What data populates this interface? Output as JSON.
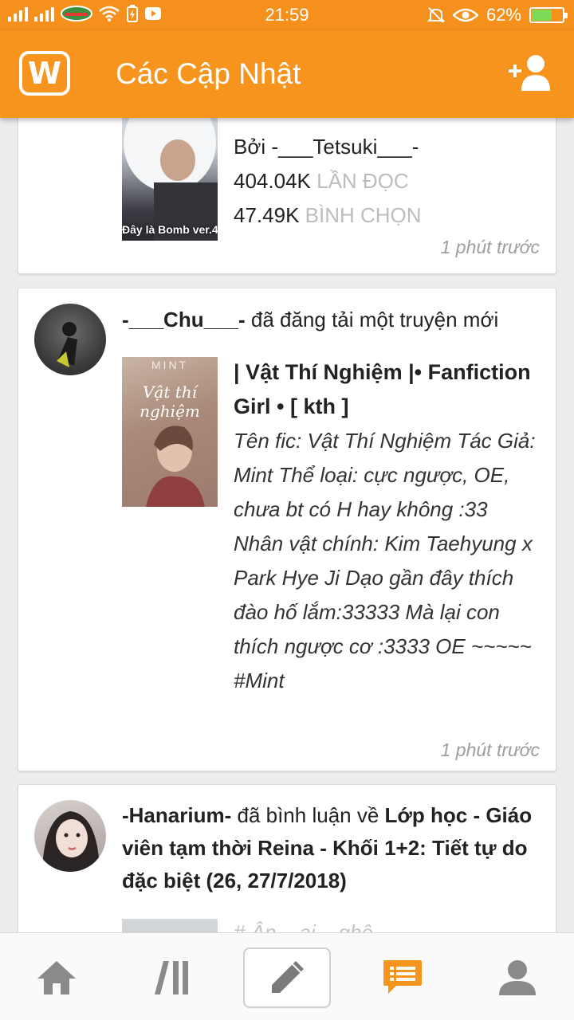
{
  "status": {
    "carrier": "VIETTEL",
    "time": "21:59",
    "battery": "62%"
  },
  "appbar": {
    "logo_letter": "W",
    "title": "Các Cập Nhật"
  },
  "cards": [
    {
      "author": "-___Tetsuki___-",
      "by_line": "Bởi -___Tetsuki___-",
      "reads_value": "404.04K",
      "reads_label": "LẦN ĐỌC",
      "votes_value": "47.49K",
      "votes_label": "BÌNH CHỌN",
      "cover_caption": "Đây là Bomb ver.4",
      "time": "1 phút trước"
    },
    {
      "user": "-___Chu___-",
      "action": "đã đăng tải một truyện mới",
      "cover_label_top": "MINT",
      "cover_title": "Vật thí nghiệm",
      "story_title": "| Vật Thí Nghiệm |• Fanfiction Girl • [ kth ]",
      "description": "Tên fic: Vật Thí Nghiệm Tác Giả: Mint Thể loại: cực ngược, OE, chưa bt có H hay không :33 Nhân vật chính: Kim Taehyung x Park Hye Ji Dạo gần đây thích đào hố lắm:33333 Mà lại con thích ngược cơ :3333 OE ~~~~~ #Mint",
      "time": "1 phút trước"
    },
    {
      "user": "-Hanarium-",
      "action": "đã bình luận về",
      "target": "Lớp học - Giáo viên tạm thời Reina - Khối 1+2: Tiết tự do đặc biệt (26, 27/7/2018)",
      "partial_text": "# Ân ...ai ...ghệ ..."
    }
  ],
  "nav": [
    "home-icon",
    "library-icon",
    "write-icon",
    "messages-icon",
    "profile-icon"
  ],
  "colors": {
    "brand": "#f7941d",
    "statusbar": "#f5901c"
  }
}
